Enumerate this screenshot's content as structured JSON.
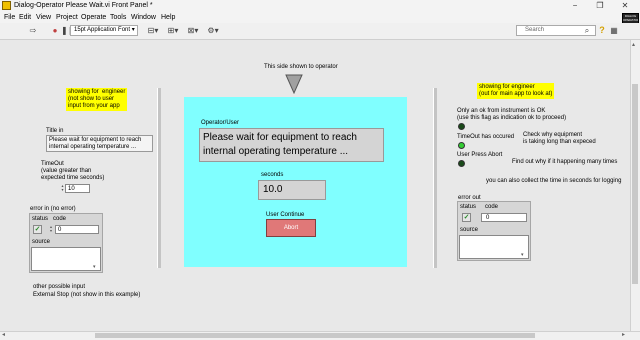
{
  "window": {
    "title": "Dialog-Operator Please Wait.vi Front Panel *",
    "minimize": "−",
    "restore": "❐",
    "close": "✕"
  },
  "menu": [
    "File",
    "Edit",
    "View",
    "Project",
    "Operate",
    "Tools",
    "Window",
    "Help"
  ],
  "toolbar": {
    "font": "15pt Application Font",
    "search_placeholder": "Search",
    "vi_icon_text": "DIALOG OPERATOR WAIT"
  },
  "left_notes": {
    "engineer_note": "showing for  engineer\n(not show to user\ninput from your app"
  },
  "title_in": {
    "label": "Title in",
    "value": "Please wait for equipment to reach internal operating temperature ..."
  },
  "timeout": {
    "label": "TimeOut\n(value greater than\nexpected time seconds)",
    "value": "10"
  },
  "error_in": {
    "label": "error in (no error)",
    "status_label": "status",
    "code_label": "code",
    "code_value": "0",
    "source_label": "source"
  },
  "other_input": "other possible input\nExternal Stop (not show in this example)",
  "operator_side": {
    "caption": "This side shown to operator",
    "panel_label": "Operator/User",
    "message": "Please wait for equipment to reach internal operating temperature ...",
    "seconds_label": "seconds",
    "seconds_value": "10.0",
    "continue_label": "User Continue",
    "abort_label": "Abort"
  },
  "right_notes": {
    "engineer_note": "showing for engineer\n(out for main app to look at)",
    "ok_note": "Only an ok from instrument is OK\n(use this flag as indication ok to proceed)",
    "timeout_flag": "TimeOut has occured",
    "check_note": "Check why equipment\nis taking long than expeced",
    "abort_flag": "User Press Abort",
    "find_note": "Find out why if it happening many times",
    "collect_note": "you can also collect the time in seconds for logging"
  },
  "error_out": {
    "label": "error out",
    "status_label": "status",
    "code_label": "code",
    "code_value": "0",
    "source_label": "source"
  },
  "colors": {
    "operator_panel": "#80ffff",
    "note": "#ffff00",
    "abort": "#e07878",
    "led_green": "#33cc33",
    "led_dark": "#1a4a1a"
  }
}
